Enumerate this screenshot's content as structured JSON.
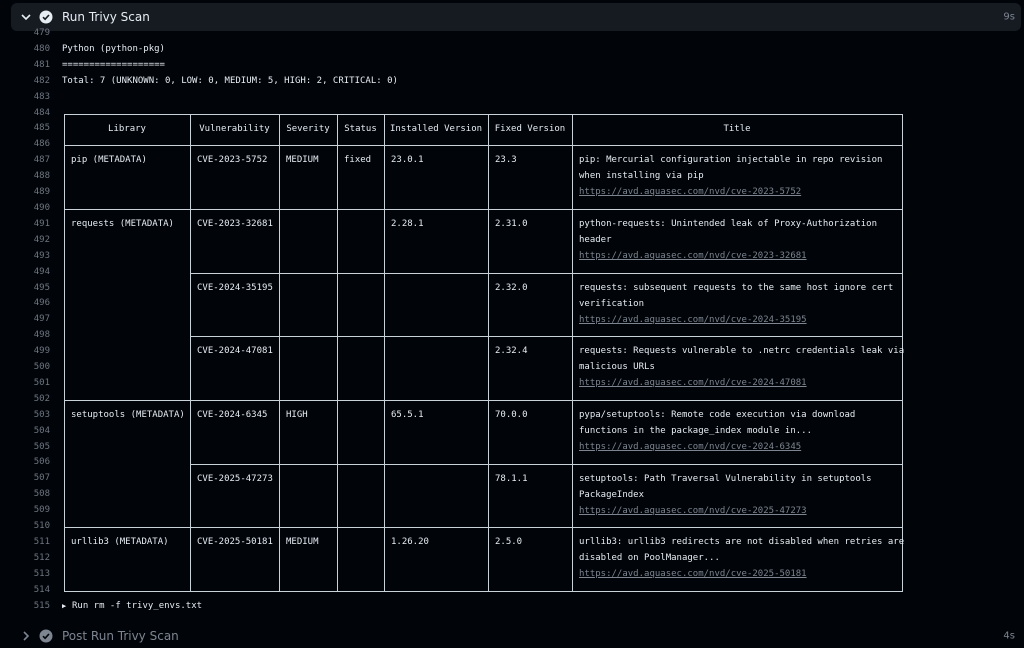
{
  "step": {
    "title": "Run Trivy Scan",
    "time": "9s",
    "status_icon": "check-circle-icon"
  },
  "post_step": {
    "title": "Post Run Trivy Scan",
    "time": "4s"
  },
  "log": {
    "lines": [
      {
        "n": "479",
        "t": ""
      },
      {
        "n": "480",
        "t": "Python (python-pkg)"
      },
      {
        "n": "481",
        "t": "==================="
      },
      {
        "n": "482",
        "t": "Total: 7 (UNKNOWN: 0, LOW: 0, MEDIUM: 5, HIGH: 2, CRITICAL: 0)"
      },
      {
        "n": "483",
        "t": ""
      },
      {
        "n": "484",
        "t": ""
      },
      {
        "n": "485",
        "t": ""
      },
      {
        "n": "486",
        "t": ""
      },
      {
        "n": "487",
        "t": ""
      },
      {
        "n": "488",
        "t": ""
      },
      {
        "n": "489",
        "t": ""
      },
      {
        "n": "490",
        "t": ""
      },
      {
        "n": "491",
        "t": ""
      },
      {
        "n": "492",
        "t": ""
      },
      {
        "n": "493",
        "t": ""
      },
      {
        "n": "494",
        "t": ""
      },
      {
        "n": "495",
        "t": ""
      },
      {
        "n": "496",
        "t": ""
      },
      {
        "n": "497",
        "t": ""
      },
      {
        "n": "498",
        "t": ""
      },
      {
        "n": "499",
        "t": ""
      },
      {
        "n": "500",
        "t": ""
      },
      {
        "n": "501",
        "t": ""
      },
      {
        "n": "502",
        "t": ""
      },
      {
        "n": "503",
        "t": ""
      },
      {
        "n": "504",
        "t": ""
      },
      {
        "n": "505",
        "t": ""
      },
      {
        "n": "506",
        "t": ""
      },
      {
        "n": "507",
        "t": ""
      },
      {
        "n": "508",
        "t": ""
      },
      {
        "n": "509",
        "t": ""
      },
      {
        "n": "510",
        "t": ""
      },
      {
        "n": "511",
        "t": ""
      },
      {
        "n": "512",
        "t": ""
      },
      {
        "n": "513",
        "t": ""
      },
      {
        "n": "514",
        "t": ""
      },
      {
        "n": "515",
        "t": "Run rm -f trivy_envs.txt",
        "caret": true
      }
    ]
  },
  "table": {
    "headers": [
      "Library",
      "Vulnerability",
      "Severity",
      "Status",
      "Installed Version",
      "Fixed Version",
      "Title"
    ],
    "rows": [
      {
        "library": "pip (METADATA)",
        "vuln": "CVE-2023-5752",
        "severity": "MEDIUM",
        "status": "fixed",
        "installed": "23.0.1",
        "fixed": "23.3",
        "title": [
          "pip: Mercurial configuration injectable in repo revision",
          "when installing via pip"
        ],
        "link": "https://avd.aquasec.com/nvd/cve-2023-5752"
      },
      {
        "library": "requests (METADATA)",
        "vuln": "CVE-2023-32681",
        "severity": "",
        "status": "",
        "installed": "2.28.1",
        "fixed": "2.31.0",
        "title": [
          "python-requests: Unintended leak of Proxy-Authorization",
          "header"
        ],
        "link": "https://avd.aquasec.com/nvd/cve-2023-32681"
      },
      {
        "library": "",
        "vuln": "CVE-2024-35195",
        "severity": "",
        "status": "",
        "installed": "",
        "fixed": "2.32.0",
        "title": [
          "requests: subsequent requests to the same host ignore cert",
          "verification"
        ],
        "link": "https://avd.aquasec.com/nvd/cve-2024-35195"
      },
      {
        "library": "",
        "vuln": "CVE-2024-47081",
        "severity": "",
        "status": "",
        "installed": "",
        "fixed": "2.32.4",
        "title": [
          "requests: Requests vulnerable to .netrc credentials leak via",
          "malicious URLs"
        ],
        "link": "https://avd.aquasec.com/nvd/cve-2024-47081"
      },
      {
        "library": "setuptools (METADATA)",
        "vuln": "CVE-2024-6345",
        "severity": "HIGH",
        "status": "",
        "installed": "65.5.1",
        "fixed": "70.0.0",
        "title": [
          "pypa/setuptools: Remote code execution via download",
          "functions in the package_index module in..."
        ],
        "link": "https://avd.aquasec.com/nvd/cve-2024-6345"
      },
      {
        "library": "",
        "vuln": "CVE-2025-47273",
        "severity": "",
        "status": "",
        "installed": "",
        "fixed": "78.1.1",
        "title": [
          "setuptools: Path Traversal Vulnerability in setuptools",
          "PackageIndex"
        ],
        "link": "https://avd.aquasec.com/nvd/cve-2025-47273"
      },
      {
        "library": "urllib3 (METADATA)",
        "vuln": "CVE-2025-50181",
        "severity": "MEDIUM",
        "status": "",
        "installed": "1.26.20",
        "fixed": "2.5.0",
        "title": [
          "urllib3: urllib3 redirects are not disabled when retries are",
          "disabled on PoolManager..."
        ],
        "link": "https://avd.aquasec.com/nvd/cve-2025-50181"
      }
    ]
  }
}
